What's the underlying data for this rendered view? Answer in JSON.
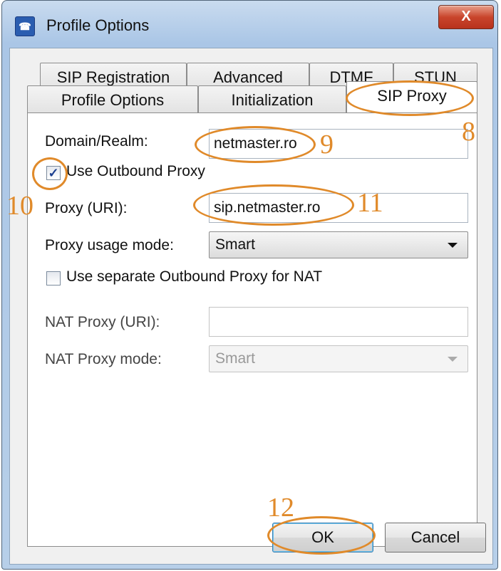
{
  "window": {
    "title": "Profile Options",
    "close_label": "X",
    "app_icon_glyph": "☎"
  },
  "tabs": {
    "row1": [
      {
        "label": "SIP Registration"
      },
      {
        "label": "Advanced"
      },
      {
        "label": "DTMF"
      },
      {
        "label": "STUN"
      }
    ],
    "row2": [
      {
        "label": "Profile Options"
      },
      {
        "label": "Initialization"
      },
      {
        "label": "SIP Proxy",
        "active": true
      }
    ]
  },
  "form": {
    "domain_label": "Domain/Realm:",
    "domain_value": "netmaster.ro",
    "use_outbound_label": "Use Outbound Proxy",
    "use_outbound_checked": true,
    "proxy_label": "Proxy (URI):",
    "proxy_value": "sip.netmaster.ro",
    "proxy_mode_label": "Proxy usage mode:",
    "proxy_mode_value": "Smart",
    "separate_nat_label": "Use separate Outbound Proxy for NAT",
    "separate_nat_checked": false,
    "nat_proxy_label": "NAT Proxy (URI):",
    "nat_proxy_value": "",
    "nat_mode_label": "NAT Proxy mode:",
    "nat_mode_value": "Smart"
  },
  "buttons": {
    "ok": "OK",
    "cancel": "Cancel"
  },
  "annotations": {
    "color": "#e08a2a",
    "n8": "8",
    "n9": "9",
    "n10": "10",
    "n11": "11",
    "n12": "12"
  }
}
